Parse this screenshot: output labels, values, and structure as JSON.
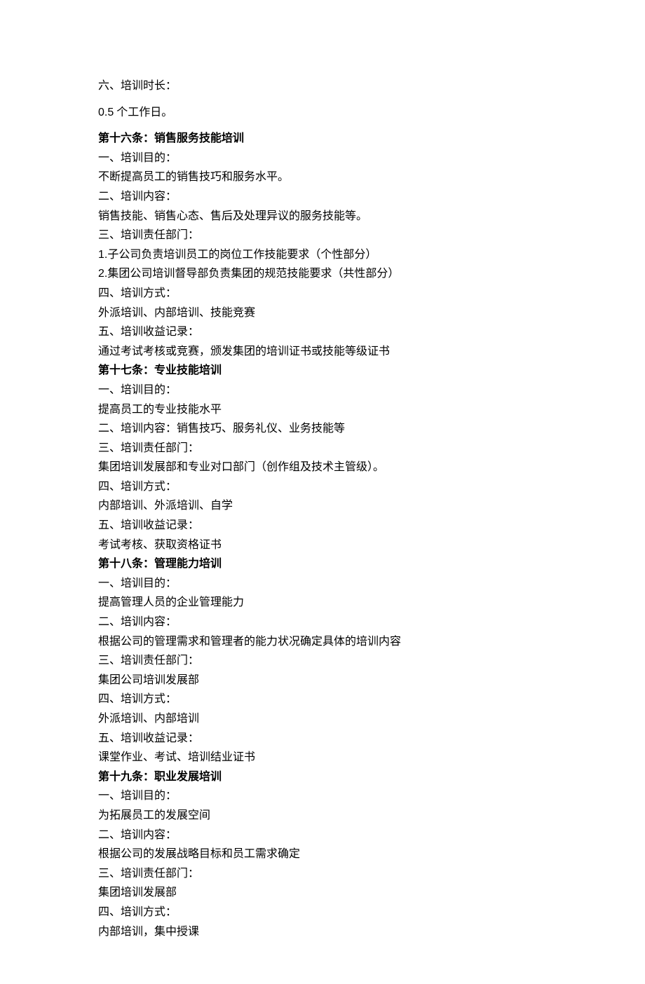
{
  "intro": {
    "line1": "六、培训时长：",
    "line2_num": "0.5",
    "line2_text": " 个工作日。"
  },
  "article16": {
    "title": "第十六条：销售服务技能培训",
    "p1": "一、培训目的：",
    "p1b": "不断提高员工的销售技巧和服务水平。",
    "p2": "二、培训内容：",
    "p2b": "销售技能、销售心态、售后及处理异议的服务技能等。",
    "p3": "三、培训责任部门：",
    "p3b_num": "1.",
    "p3b_text": "子公司负责培训员工的岗位工作技能要求（个性部分）",
    "p3c_num": "2.",
    "p3c_text": "集团公司培训督导部负责集团的规范技能要求（共性部分）",
    "p4": "四、培训方式：",
    "p4b": "外派培训、内部培训、技能竞赛",
    "p5": "五、培训收益记录：",
    "p5b": "通过考试考核或竞赛，颁发集团的培训证书或技能等级证书"
  },
  "article17": {
    "title": "第十七条：专业技能培训",
    "p1": "一、培训目的：",
    "p1b": "提高员工的专业技能水平",
    "p2": "二、培训内容：销售技巧、服务礼仪、业务技能等",
    "p3": "三、培训责任部门：",
    "p3b": "集团培训发展部和专业对口部门（创作组及技术主管级）。",
    "p4": "四、培训方式：",
    "p4b": "内部培训、外派培训、自学",
    "p5": "五、培训收益记录：",
    "p5b": "考试考核、获取资格证书"
  },
  "article18": {
    "title": "第十八条：管理能力培训",
    "p1": "一、培训目的：",
    "p1b": "提高管理人员的企业管理能力",
    "p2": "二、培训内容：",
    "p2b": "根据公司的管理需求和管理者的能力状况确定具体的培训内容",
    "p3": "三、培训责任部门：",
    "p3b": "集团公司培训发展部",
    "p4": "四、培训方式：",
    "p4b": "外派培训、内部培训",
    "p5": "五、培训收益记录：",
    "p5b": "课堂作业、考试、培训结业证书"
  },
  "article19": {
    "title": "第十九条：职业发展培训",
    "p1": "一、培训目的：",
    "p1b": "为拓展员工的发展空间",
    "p2": "二、培训内容：",
    "p2b": "根据公司的发展战略目标和员工需求确定",
    "p3": "三、培训责任部门：",
    "p3b": "集团培训发展部",
    "p4": "四、培训方式：",
    "p4b": "内部培训，集中授课"
  }
}
